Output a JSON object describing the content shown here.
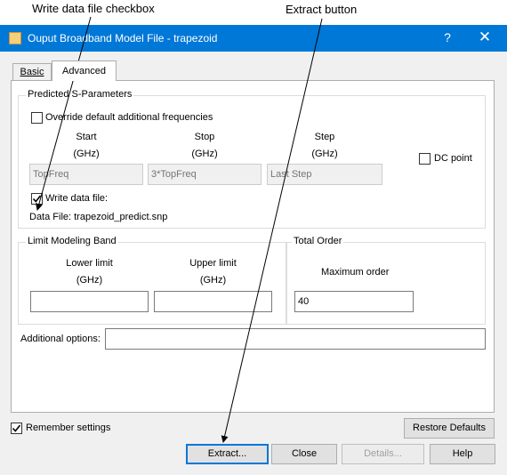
{
  "annotations": {
    "write_checkbox": "Write data file checkbox",
    "extract_button": "Extract button"
  },
  "window": {
    "title": "Ouput Broadband Model File - trapezoid",
    "help_glyph": "?",
    "close_glyph": "✕"
  },
  "tabs": [
    {
      "label": "Basic",
      "active": false
    },
    {
      "label": "Advanced",
      "active": true
    }
  ],
  "predicted": {
    "legend": "Predicted S-Parameters",
    "override_label": "Override default additional frequencies",
    "override_checked": false,
    "columns": [
      {
        "label": "Start",
        "unit": "(GHz)",
        "placeholder": "TopFreq"
      },
      {
        "label": "Stop",
        "unit": "(GHz)",
        "placeholder": "3*TopFreq"
      },
      {
        "label": "Step",
        "unit": "(GHz)",
        "placeholder": "Last Step"
      }
    ],
    "dc_point_label": "DC point",
    "dc_point_checked": false,
    "write_label": "Write data file:",
    "write_checked": true,
    "data_file_label": "Data File: trapezoid_predict.snp"
  },
  "limit_band": {
    "legend": "Limit Modeling Band",
    "lower_label": "Lower limit",
    "lower_unit": "(GHz)",
    "lower_value": "",
    "upper_label": "Upper limit",
    "upper_unit": "(GHz)",
    "upper_value": ""
  },
  "total_order": {
    "legend": "Total Order",
    "max_label": "Maximum order",
    "max_value": "40"
  },
  "additional": {
    "label": "Additional options:",
    "value": ""
  },
  "remember": {
    "label": "Remember settings",
    "checked": true
  },
  "buttons": {
    "restore": "Restore Defaults",
    "extract": "Extract...",
    "close": "Close",
    "details": "Details...",
    "help": "Help"
  }
}
